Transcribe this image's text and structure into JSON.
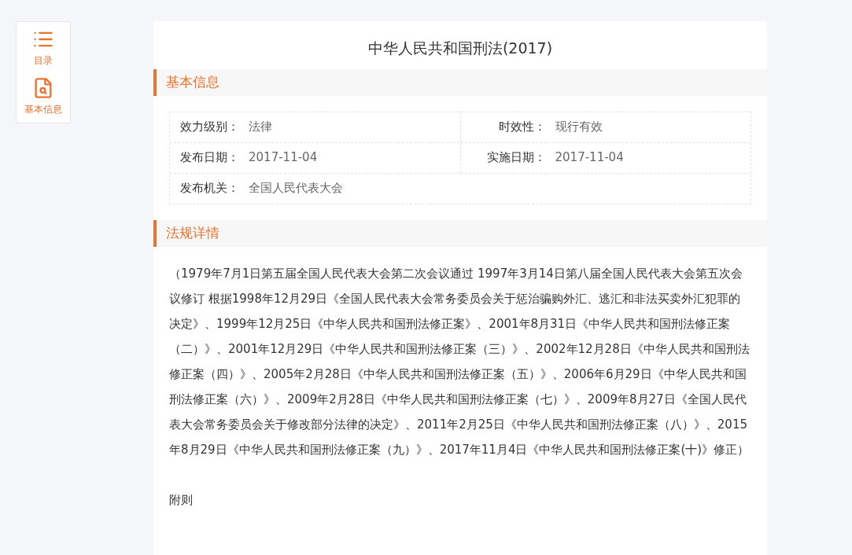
{
  "sidebar": {
    "items": [
      {
        "kind": "list",
        "label": "目录"
      },
      {
        "kind": "search-doc",
        "label": "基本信息"
      }
    ]
  },
  "title": "中华人民共和国刑法(2017)",
  "basic_info": {
    "heading": "基本信息",
    "rows": [
      [
        {
          "label": "效力级别：",
          "value": "法律"
        },
        {
          "label": "时效性：",
          "value": "现行有效"
        }
      ],
      [
        {
          "label": "发布日期：",
          "value": "2017-11-04"
        },
        {
          "label": "实施日期：",
          "value": "2017-11-04"
        }
      ],
      [
        {
          "label": "发布机关：",
          "value": "全国人民代表大会"
        }
      ]
    ]
  },
  "details": {
    "heading": "法规详情",
    "paragraphs": [
      "（1979年7月1日第五届全国人民代表大会第二次会议通过 1997年3月14日第八届全国人民代表大会第五次会议修订 根据1998年12月29日《全国人民代表大会常务委员会关于惩治骗购外汇、逃汇和非法买卖外汇犯罪的决定》、1999年12月25日《中华人民共和国刑法修正案》、2001年8月31日《中华人民共和国刑法修正案（二）》、2001年12月29日《中华人民共和国刑法修正案（三）》、2002年12月28日《中华人民共和国刑法修正案（四）》、2005年2月28日《中华人民共和国刑法修正案（五）》、2006年6月29日《中华人民共和国刑法修正案（六）》、2009年2月28日《中华人民共和国刑法修正案（七）》、2009年8月27日《全国人民代表大会常务委员会关于修改部分法律的决定》、2011年2月25日《中华人民共和国刑法修正案（八）》、2015年8月29日《中华人民共和国刑法修正案（九）》、2017年11月4日《中华人民共和国刑法修正案(十)》修正）",
      "附则"
    ]
  }
}
